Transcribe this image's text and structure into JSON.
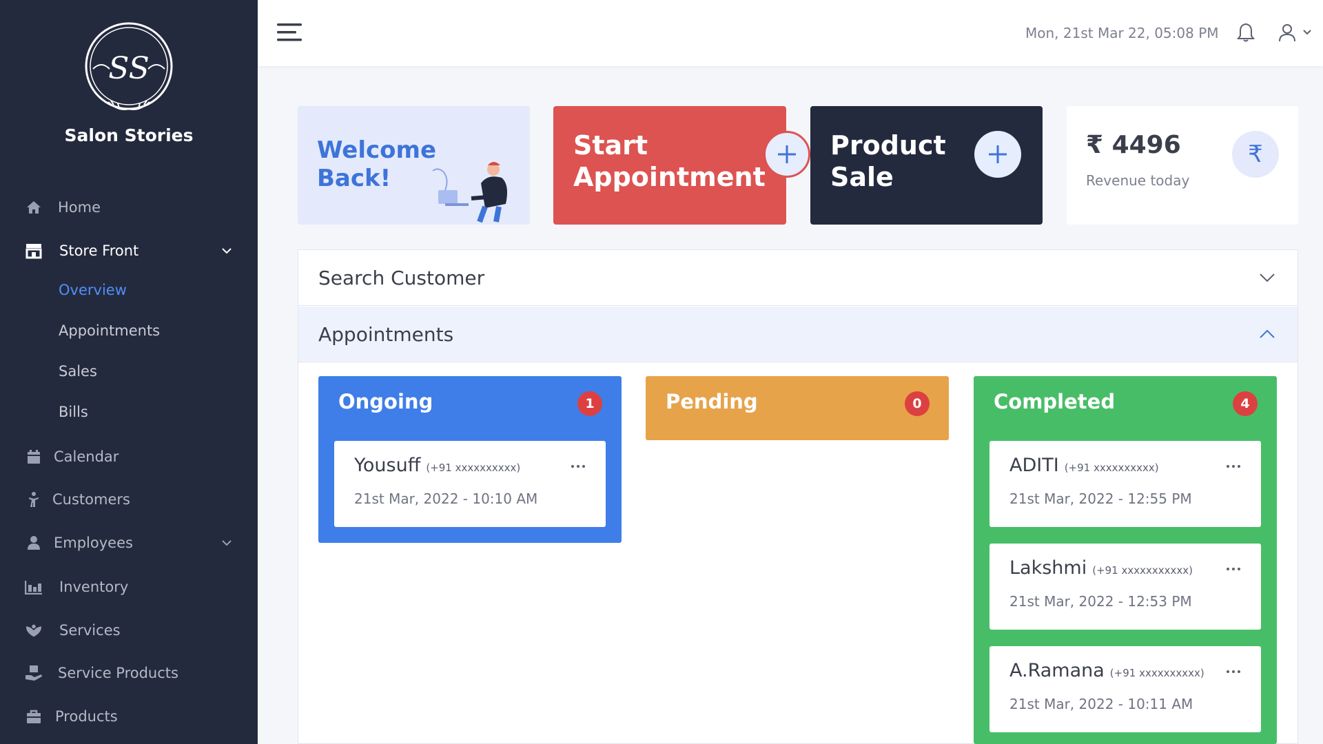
{
  "app": {
    "name": "Salon Stories",
    "logo_text": "SS"
  },
  "sidebar": {
    "items": [
      {
        "label": "Home",
        "icon": "home-icon"
      },
      {
        "label": "Store Front",
        "icon": "store-icon"
      },
      {
        "label": "Calendar",
        "icon": "calendar-icon"
      },
      {
        "label": "Customers",
        "icon": "customers-icon"
      },
      {
        "label": "Employees",
        "icon": "employee-icon"
      },
      {
        "label": "Inventory",
        "icon": "inventory-icon"
      },
      {
        "label": "Services",
        "icon": "services-icon"
      },
      {
        "label": "Service Products",
        "icon": "service-products-icon"
      },
      {
        "label": "Products",
        "icon": "products-icon"
      }
    ],
    "store_front_sub": [
      {
        "label": "Overview",
        "current": true
      },
      {
        "label": "Appointments"
      },
      {
        "label": "Sales"
      },
      {
        "label": "Bills"
      }
    ]
  },
  "header": {
    "datetime": "Mon, 21st Mar 22, 05:08 PM"
  },
  "cards": {
    "welcome": {
      "line1": "Welcome",
      "line2": "Back!"
    },
    "start": {
      "line1": "Start",
      "line2": "Appointment"
    },
    "product": {
      "line1": "Product",
      "line2": "Sale"
    },
    "revenue": {
      "amount": "₹ 4496",
      "label": "Revenue today",
      "icon": "₹"
    }
  },
  "panels": {
    "search": "Search Customer",
    "appointments": "Appointments"
  },
  "columns": {
    "ongoing": {
      "title": "Ongoing",
      "count": "1",
      "items": [
        {
          "name": "Yousuff",
          "phone": "(+91 xxxxxxxxxx)",
          "datetime": "21st Mar, 2022 - 10:10 AM"
        }
      ]
    },
    "pending": {
      "title": "Pending",
      "count": "0",
      "items": []
    },
    "completed": {
      "title": "Completed",
      "count": "4",
      "items": [
        {
          "name": "ADITI",
          "phone": "(+91 xxxxxxxxxx)",
          "datetime": "21st Mar, 2022 - 12:55 PM"
        },
        {
          "name": "Lakshmi",
          "phone": "(+91 xxxxxxxxxxx)",
          "datetime": "21st Mar, 2022 - 12:53 PM"
        },
        {
          "name": "A.Ramana",
          "phone": "(+91 xxxxxxxxxx)",
          "datetime": "21st Mar, 2022 - 10:11 AM"
        }
      ]
    }
  },
  "colors": {
    "sidebar_bg": "#242a3e",
    "accent_blue": "#3f7ee8",
    "start_red": "#dd5351",
    "pending_orange": "#e6a34a",
    "completed_green": "#48bd68",
    "badge_red": "#dd4040",
    "active_link": "#4f8ff7"
  }
}
